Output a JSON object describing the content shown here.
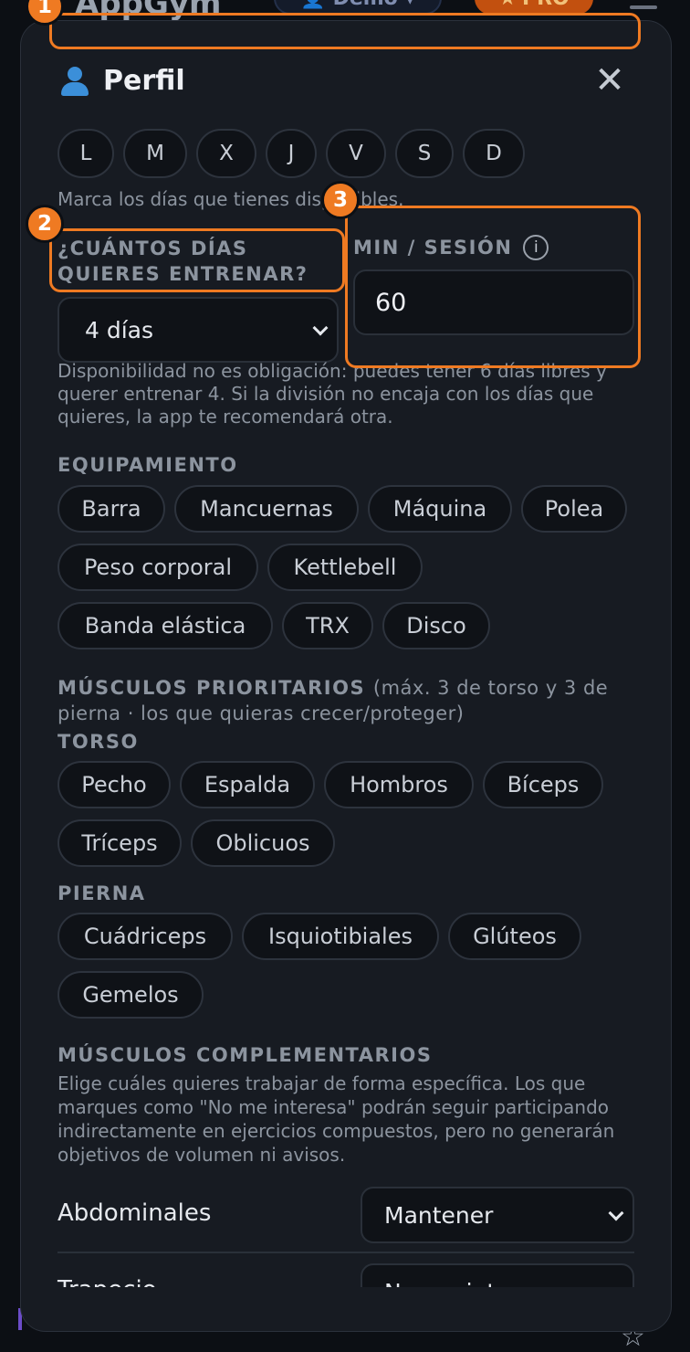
{
  "background": {
    "app_name": "AppGym",
    "user_label": "Demo",
    "pro_label": "PRO"
  },
  "modal": {
    "title": "Perfil",
    "days": [
      "L",
      "M",
      "X",
      "J",
      "V",
      "S",
      "D"
    ],
    "days_hint": "Marca los días que tienes disponibles.",
    "train_days_label": "¿CUÁNTOS DÍAS QUIERES ENTRENAR?",
    "train_days_value": "4 días",
    "min_session_label": "MIN / SESIÓN",
    "info_icon_glyph": "i",
    "min_session_value": "60",
    "availability_note": "Disponibilidad no es obligación: puedes tener 6 días libres y querer entrenar 4. Si la división no encaja con los días que quieres, la app te recomendará otra.",
    "equipment_label": "EQUIPAMIENTO",
    "equipment": [
      "Barra",
      "Mancuernas",
      "Máquina",
      "Polea",
      "Peso corporal",
      "Kettlebell",
      "Banda elástica",
      "TRX",
      "Disco"
    ],
    "priority_label": "MÚSCULOS PRIORITARIOS",
    "priority_hint": "(máx. 3 de torso y 3 de pierna · los que quieras crecer/proteger)",
    "torso_label": "TORSO",
    "torso": [
      "Pecho",
      "Espalda",
      "Hombros",
      "Bíceps",
      "Tríceps",
      "Oblicuos"
    ],
    "leg_label": "PIERNA",
    "leg": [
      "Cuádriceps",
      "Isquiotibiales",
      "Glúteos",
      "Gemelos"
    ],
    "complementary_label": "MÚSCULOS COMPLEMENTARIOS",
    "complementary_hint": "Elige cuáles quieres trabajar de forma específica. Los que marques como \"No me interesa\" podrán seguir participando indirectamente en ejercicios compuestos, pero no generarán objetivos de volumen ni avisos.",
    "complementary_rows": [
      {
        "label": "Abdominales",
        "value": "Mantener"
      },
      {
        "label": "Trapecio",
        "value": "No me interesa"
      }
    ]
  },
  "annotations": {
    "badges": [
      "1",
      "2",
      "3"
    ],
    "color": "#ef7a22"
  }
}
